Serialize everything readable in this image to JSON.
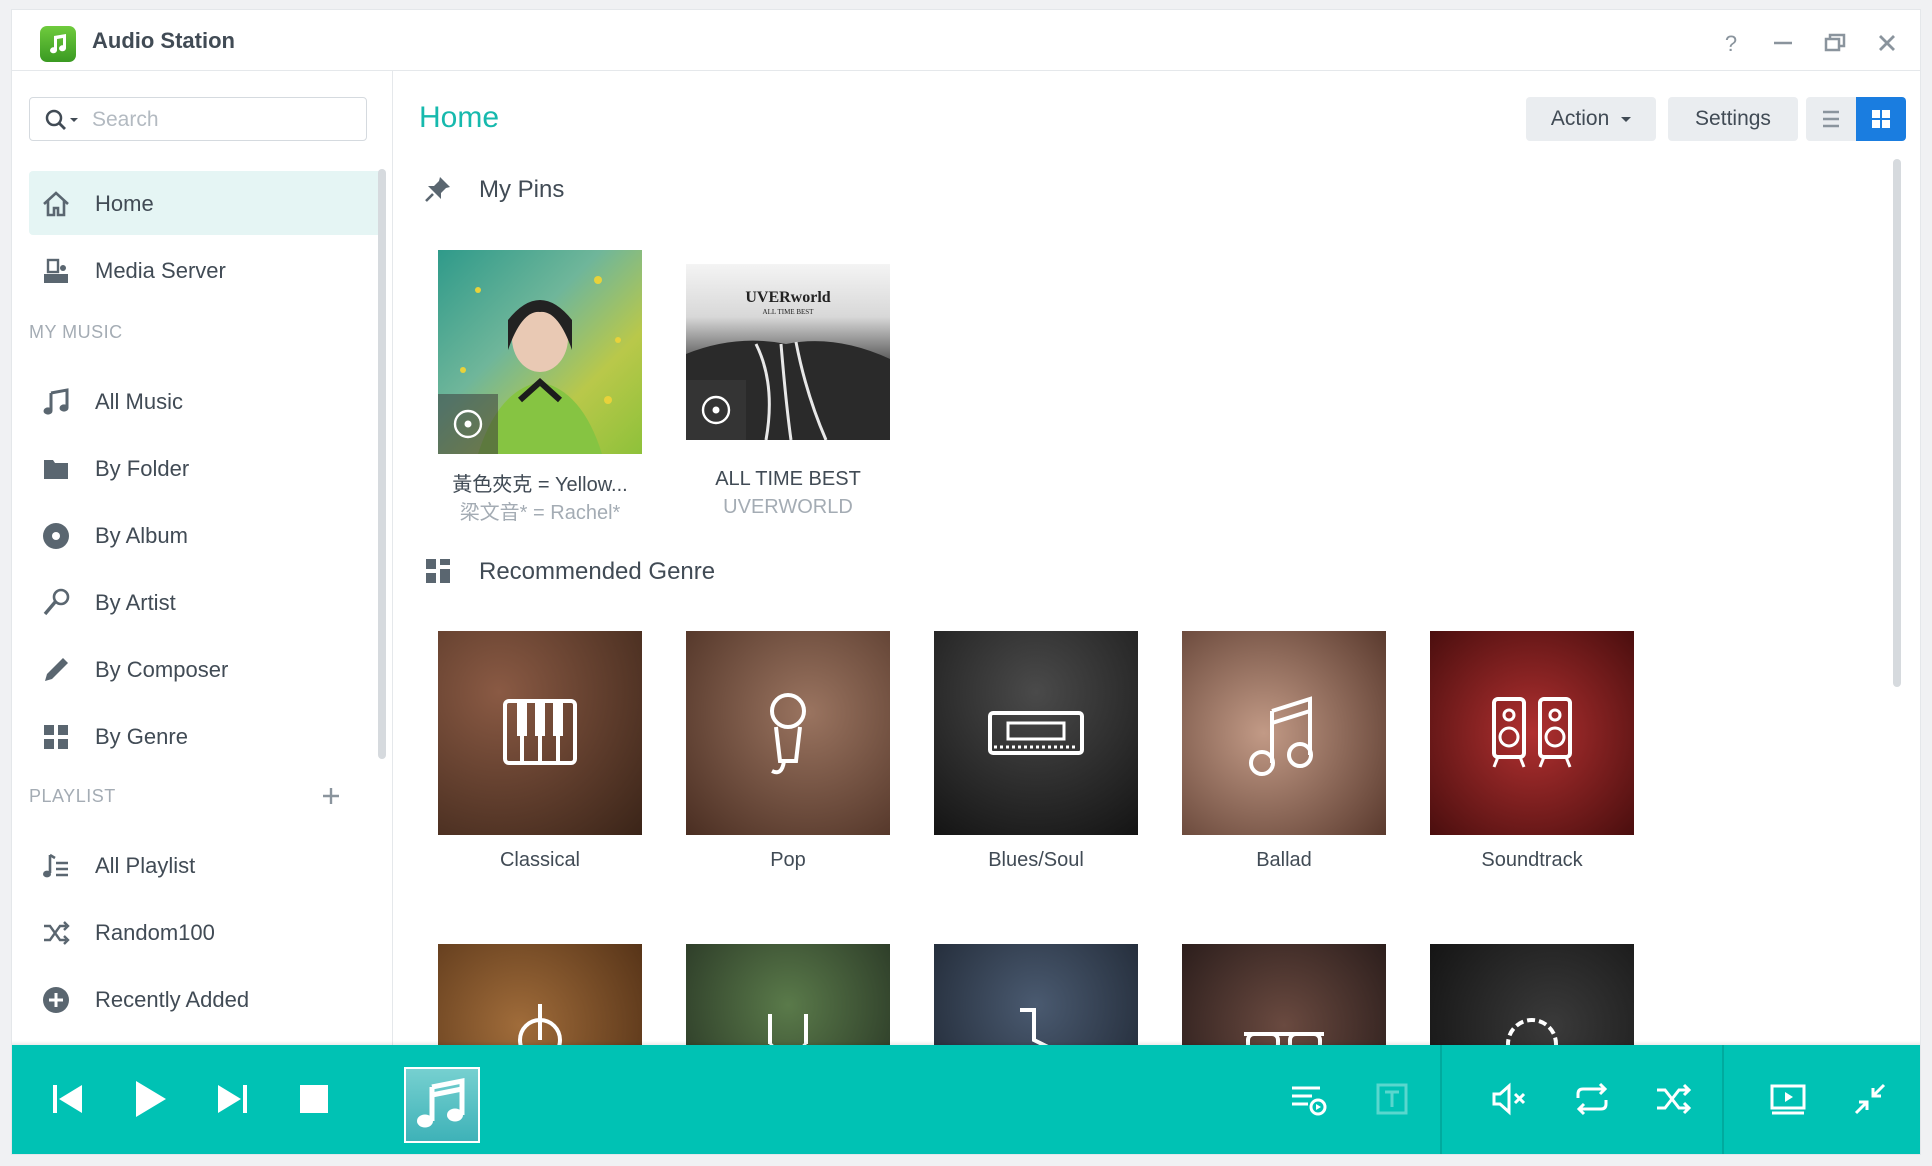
{
  "window": {
    "title": "Audio Station",
    "controls": [
      "help-icon",
      "minimize-icon",
      "restore-icon",
      "close-icon"
    ]
  },
  "sidebar": {
    "search_placeholder": "Search",
    "top_items": [
      {
        "label": "Home",
        "icon": "home-icon",
        "active": true
      },
      {
        "label": "Media Server",
        "icon": "media-server-icon"
      }
    ],
    "my_music_heading": "MY MUSIC",
    "my_music_items": [
      {
        "label": "All Music",
        "icon": "music-note-icon"
      },
      {
        "label": "By Folder",
        "icon": "folder-icon"
      },
      {
        "label": "By Album",
        "icon": "album-disc-icon"
      },
      {
        "label": "By Artist",
        "icon": "microphone-icon"
      },
      {
        "label": "By Composer",
        "icon": "pen-icon"
      },
      {
        "label": "By Genre",
        "icon": "genre-grid-icon"
      }
    ],
    "playlist_heading": "PLAYLIST",
    "playlist_items": [
      {
        "label": "All Playlist",
        "icon": "playlist-icon"
      },
      {
        "label": "Random100",
        "icon": "shuffle-icon"
      },
      {
        "label": "Recently Added",
        "icon": "plus-circle-icon"
      }
    ]
  },
  "main": {
    "title": "Home",
    "toolbar": {
      "action_label": "Action",
      "settings_label": "Settings"
    },
    "pins_title": "My Pins",
    "pins": [
      {
        "title": "黃色夾克 = Yellow...",
        "subtitle": "梁文音* = Rachel*"
      },
      {
        "title": "ALL TIME BEST",
        "subtitle": "UVERWORLD"
      }
    ],
    "genre_title": "Recommended Genre",
    "genres": [
      {
        "label": "Classical",
        "icon": "piano-keys-icon",
        "color": "#5a3a2e"
      },
      {
        "label": "Pop",
        "icon": "microphone-icon",
        "color": "#6b4a3c"
      },
      {
        "label": "Blues/Soul",
        "icon": "harmonica-icon",
        "color": "#2c2c2c"
      },
      {
        "label": "Ballad",
        "icon": "music-note-icon",
        "color": "#8a6a5a"
      },
      {
        "label": "Soundtrack",
        "icon": "speakers-icon",
        "color": "#8a1e1e"
      }
    ],
    "genres_row2": [
      {
        "icon": "guitar-icon",
        "color": "#7a4e2a"
      },
      {
        "icon": "rock-hand-icon",
        "color": "#3a4a3a"
      },
      {
        "icon": "saxophone-icon",
        "color": "#2a3444"
      },
      {
        "icon": "sunglasses-icon",
        "color": "#3a2a2a"
      },
      {
        "icon": "flower-icon",
        "color": "#1e1e1e"
      }
    ]
  },
  "player": {
    "controls": [
      "previous-icon",
      "play-icon",
      "next-icon",
      "stop-icon"
    ],
    "right_controls": [
      "queue-icon",
      "lyrics-icon",
      "mute-icon",
      "repeat-icon",
      "shuffle-icon",
      "fullscreen-player-icon",
      "mini-mode-icon"
    ]
  }
}
